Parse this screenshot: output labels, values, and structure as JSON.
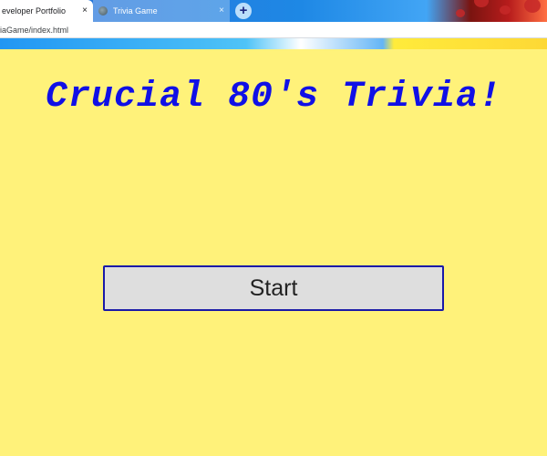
{
  "browser": {
    "tabs": [
      {
        "label": "eveloper Portfolio",
        "close_glyph": "×",
        "active": true
      },
      {
        "label": "Trivia Game",
        "close_glyph": "×",
        "active": false
      }
    ],
    "new_tab_glyph": "+",
    "address": "iaGame/index.html"
  },
  "page": {
    "title": "Crucial 80's Trivia!",
    "start_label": "Start",
    "background_color": "#fff27a",
    "title_color": "#1010e6",
    "button_border_color": "#1a1aa8"
  },
  "icons": {
    "tab_favicon": "globe-icon",
    "tab_close": "close-icon",
    "new_tab": "plus-icon"
  }
}
